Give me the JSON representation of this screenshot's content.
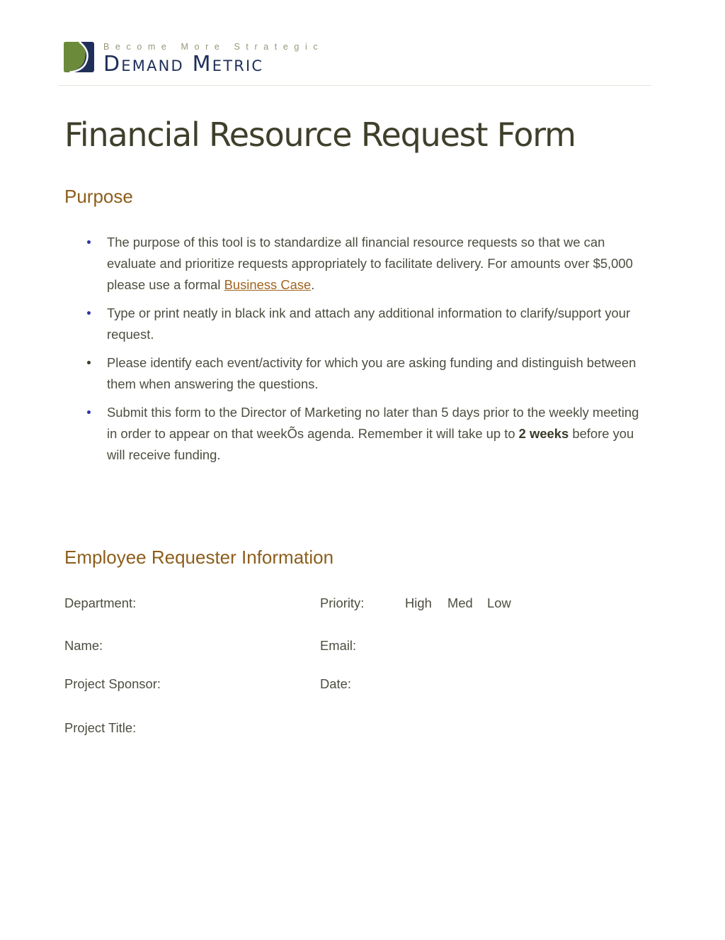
{
  "header": {
    "logo_icon": "demand-metric-logo-mark",
    "tagline": "Become More Strategic",
    "brand": "Demand Metric",
    "colors": {
      "brand_navy": "#1f2f5a",
      "brand_green": "#6b8a3a",
      "tagline": "#9a9678"
    }
  },
  "document": {
    "title": "Financial Resource Request Form",
    "colors": {
      "heading_accent": "#8c5e1c",
      "bullet_blue": "#2a35a8",
      "link": "#a0651f"
    }
  },
  "purpose": {
    "heading": "Purpose",
    "items": [
      {
        "text_before": "The purpose of this tool is to standardize all financial resource requests so that we can evaluate and prioritize requests appropriately to facilitate delivery.  For amounts over $5,000 please use a formal ",
        "link": "Business Case",
        "text_after": "."
      },
      {
        "text": "Type or print neatly in black ink and attach any additional information to clarify/support your request."
      },
      {
        "text": "Please identify each event/activity for which you are asking funding and distinguish between them when answering the questions."
      },
      {
        "text_before": "Submit this form to the Director of Marketing no later than 5 days prior to the weekly meeting in order to appear on that weekÕs agenda. Remember it will take up to ",
        "bold": "2 weeks",
        "text_after": " before you will receive funding."
      }
    ]
  },
  "requester": {
    "heading": "Employee Requester Information",
    "fields": {
      "department": "Department:",
      "priority": "Priority:",
      "priority_options": [
        "High",
        "Med",
        "Low"
      ],
      "name": "Name:",
      "email": "Email:",
      "project_sponsor": "Project Sponsor:",
      "date": "Date:",
      "project_title": "Project Title:"
    }
  }
}
